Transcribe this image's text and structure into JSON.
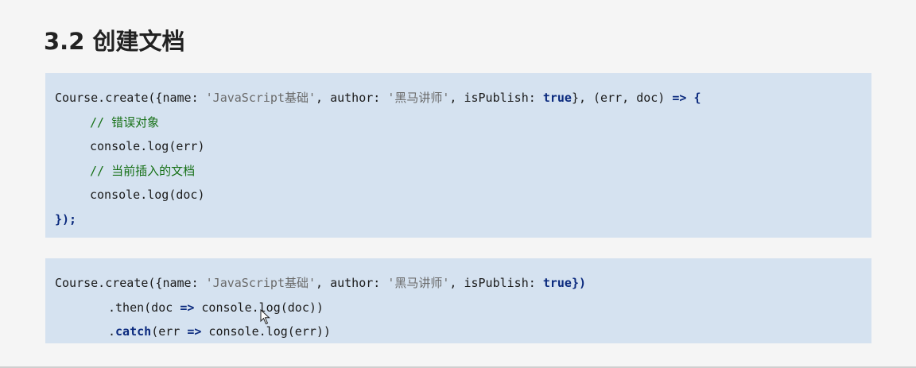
{
  "slide": {
    "title": "3.2 创建文档"
  },
  "code_block_1": {
    "line1": {
      "a": "Course.create({name: ",
      "b": "'JavaScript基础'",
      "c": ", author: ",
      "d": "'黑马讲师'",
      "e": ", isPublish: ",
      "f": "true",
      "g": "}, (err, doc) ",
      "h": "=>",
      "i": " {"
    },
    "line2": "// 错误对象",
    "line3": "console.log(err)",
    "line4": "// 当前插入的文档",
    "line5": "console.log(doc)",
    "line6": "});"
  },
  "code_block_2": {
    "line1": {
      "a": "Course.create({name: ",
      "b": "'JavaScript基础'",
      "c": ", author: ",
      "d": "'黑马讲师'",
      "e": ", isPublish: ",
      "f": "true",
      "g": "})"
    },
    "line2": {
      "a": ".then(doc ",
      "b": "=>",
      "c": " console.log(doc))"
    },
    "line3": {
      "a": ".",
      "b": "catch",
      "c": "(err ",
      "d": "=>",
      "e": " console.log(err))"
    }
  },
  "colors": {
    "background": "#f5f5f5",
    "code_background": "#d5e2f0",
    "keyword": "#0b2a7e",
    "string": "#6a6a6a",
    "comment": "#167016"
  },
  "icons": {
    "cursor": "mouse-pointer-icon"
  }
}
